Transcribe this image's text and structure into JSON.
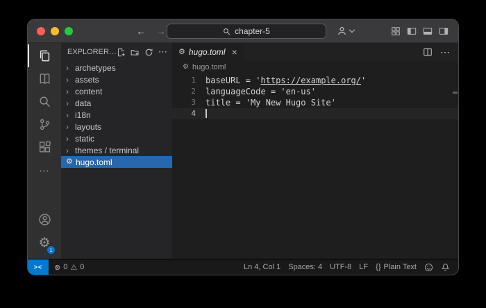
{
  "colors": {
    "accent_blue": "#0078d4",
    "selection_blue": "#2667ad",
    "traffic_red": "#ff5f57",
    "traffic_yellow": "#febc2e",
    "traffic_green": "#28c840"
  },
  "icons": {
    "back_arrow": "←",
    "forward_arrow": "→",
    "more": "⋯",
    "chevron_right": "›",
    "gear": "⚙",
    "close": "×",
    "error": "⊗",
    "warning": "⚠",
    "remote": "><"
  },
  "titlebar": {
    "search_value": "chapter-5"
  },
  "activity_bar": {
    "settings_badge": "1"
  },
  "sidebar": {
    "title": "EXPLORER…",
    "items": [
      {
        "label": "archetypes",
        "type": "folder"
      },
      {
        "label": "assets",
        "type": "folder"
      },
      {
        "label": "content",
        "type": "folder"
      },
      {
        "label": "data",
        "type": "folder"
      },
      {
        "label": "i18n",
        "type": "folder"
      },
      {
        "label": "layouts",
        "type": "folder"
      },
      {
        "label": "static",
        "type": "folder"
      },
      {
        "label": "themes / terminal",
        "type": "folder"
      },
      {
        "label": "hugo.toml",
        "type": "file",
        "selected": true
      }
    ]
  },
  "editor": {
    "tab": {
      "label": "hugo.toml"
    },
    "breadcrumb": "hugo.toml",
    "code": {
      "lines": [
        {
          "num": "1",
          "key": "baseURL",
          "op": " = ",
          "pre": "'",
          "link": "https://example.org/",
          "post": "'"
        },
        {
          "num": "2",
          "key": "languageCode",
          "op": " = ",
          "pre": "'en-us'",
          "link": "",
          "post": ""
        },
        {
          "num": "3",
          "key": "title",
          "op": " = ",
          "pre": "'My New Hugo Site'",
          "link": "",
          "post": ""
        },
        {
          "num": "4",
          "key": "",
          "op": "",
          "pre": "",
          "link": "",
          "post": ""
        }
      ]
    }
  },
  "status_bar": {
    "errors": "0",
    "warnings": "0",
    "cursor_position": "Ln 4, Col 1",
    "indentation": "Spaces: 4",
    "encoding": "UTF-8",
    "eol": "LF",
    "language_icon": "{}",
    "language": "Plain Text"
  }
}
